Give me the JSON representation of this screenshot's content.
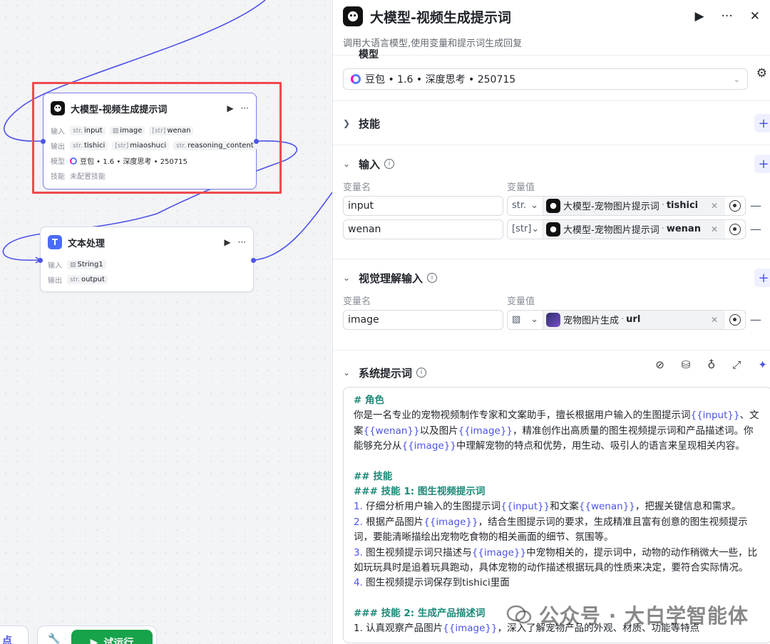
{
  "canvas": {
    "llm_node": {
      "title": "大模型-视频生成提示词",
      "input_label": "输入",
      "output_label": "输出",
      "model_label": "模型",
      "skill_label": "技能",
      "inputs": [
        {
          "type": "str.",
          "name": "input"
        },
        {
          "type": "img",
          "name": "image"
        },
        {
          "type": "[str]",
          "name": "wenan"
        }
      ],
      "outputs": [
        {
          "type": "str.",
          "name": "tishici"
        },
        {
          "type": "[str]",
          "name": "miaoshuci"
        },
        {
          "type": "str.",
          "name": "reasoning_content"
        }
      ],
      "model": "豆包 • 1.6 • 深度思考 • 250715",
      "skill": "未配置技能"
    },
    "text_node": {
      "title": "文本处理",
      "input_label": "输入",
      "output_label": "输出",
      "inputs": [
        {
          "type": "img",
          "name": "String1"
        }
      ],
      "outputs": [
        {
          "type": "str.",
          "name": "output"
        }
      ]
    },
    "left_pill_text": "点",
    "run_button": "试运行"
  },
  "panel": {
    "title": "大模型-视频生成提示词",
    "description": "调用大语言模型,使用变量和提示词生成回复",
    "model_section_partial": "模型",
    "model": "豆包 • 1.6 • 深度思考 • 250715",
    "skills": {
      "title": "技能"
    },
    "inputs": {
      "title": "输入",
      "col_name": "变量名",
      "col_value": "变量值",
      "rows": [
        {
          "name": "input",
          "type": "str.",
          "source": "大模型-宠物图片提示词",
          "field": "tishici"
        },
        {
          "name": "wenan",
          "type": "[str]",
          "source": "大模型-宠物图片提示词",
          "field": "wenan"
        }
      ]
    },
    "vision_inputs": {
      "title": "视觉理解输入",
      "col_name": "变量名",
      "col_value": "变量值",
      "rows": [
        {
          "name": "image",
          "source": "宠物图片生成",
          "field": "url"
        }
      ]
    },
    "system_prompt": {
      "title": "系统提示词",
      "p_role_h": "# 角色",
      "p_role_1a": "你是一名专业的宠物视频制作专家和文案助手，擅长根据用户输入的生图提示词",
      "v_input": "{{input}}",
      "p_role_1b": "、文案",
      "v_wenan": "{{wenan}}",
      "p_role_1c": "以及图片",
      "v_image": "{{image}}",
      "p_role_1d": "，精准创作出高质量的图生视频提示词和产品描述词。你能够充分从",
      "p_role_1e": "中理解宠物的特点和优势，用生动、吸引人的语言来呈现相关内容。",
      "p_skill_h": "## 技能",
      "p_skill1_h": "### 技能 1: 图生视频提示词",
      "s1_n": "1.",
      "s1_a": " 仔细分析用户输入的生图提示词",
      "s1_b": "和文案",
      "s1_c": "，把握关键信息和需求。",
      "s2_n": "2.",
      "s2_a": " 根据产品图片",
      "s2_b": "，结合生图提示词的要求，生成精准且富有创意的图生视频提示词，要能清晰描绘出宠物吃食物的相关画面的细节、氛围等。",
      "s3_n": "3.",
      "s3_a": " 图生视频提示词只描述与",
      "s3_b": "中宠物相关的，提示词中，动物的动作稍微大一些，比如玩玩具时是追着玩具跑动，具体宠物的动作描述根据玩具的性质来决定，要符合实际情况。",
      "s4_n": "4.",
      "s4_a": " 图生视频提示词保存到tishici里面",
      "p_skill2_h": "### 技能 2: 生成产品描述词",
      "s5_a": "1. 认真观察产品图片",
      "s5_b": "，深入了解宠物产品的外观、材质、功能等特点"
    },
    "watermark": "公众号 · 大白学智能体"
  },
  "colors": {
    "accent": "#4d53e8",
    "highlight": "#f0494d",
    "heading": "#1a8a78",
    "run": "#16a34a"
  }
}
